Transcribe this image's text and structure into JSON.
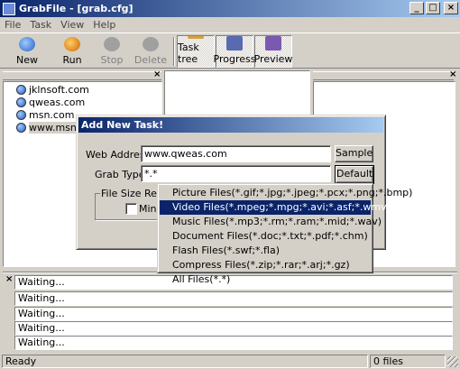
{
  "window": {
    "title": "GrabFile - [grab.cfg]",
    "buttons": [
      "_",
      "□",
      "×"
    ]
  },
  "menu": [
    "File",
    "Task",
    "View",
    "Help"
  ],
  "toolbar": {
    "new": "New",
    "run": "Run",
    "stop": "Stop",
    "delete": "Delete",
    "task_tree": "Task tree",
    "progress": "Progress",
    "preview": "Preview"
  },
  "tree": {
    "items": [
      "jklnsoft.com",
      "qweas.com",
      "msn.com",
      "www.msn..."
    ]
  },
  "dialog": {
    "title": "Add New Task!",
    "web_address_label": "Web Address:",
    "web_address_value": "www.qweas.com",
    "sample_button": "Sample",
    "grab_type_label": "Grab Type:",
    "grab_type_value": "*.*",
    "default_button": "Default",
    "file_size_group": "File Size Restric",
    "min_label": "Min"
  },
  "grab_type_menu": [
    "Picture Files(*.gif;*.jpg;*.jpeg;*.pcx;*.png;*.bmp)",
    "Video Files(*.mpeg;*.mpg;*.avi;*.asf;*.wmv)",
    "Music Files(*.mp3;*.rm;*.ram;*.mid;*.wav)",
    "Document Files(*.doc;*.txt;*.pdf;*.chm)",
    "Flash Files(*.swf;*.fla)",
    "Compress Files(*.zip;*.rar;*.arj;*.gz)",
    "All Files(*.*)"
  ],
  "grab_type_menu_highlighted": 1,
  "status_list": [
    "Waiting...",
    "Waiting...",
    "Waiting...",
    "Waiting...",
    "Waiting..."
  ],
  "statusbar": {
    "status": "Ready",
    "files": "0 files"
  },
  "colors": {
    "titlebar": "#0a246a",
    "highlight": "#0a246a",
    "face": "#d4d0c8"
  }
}
